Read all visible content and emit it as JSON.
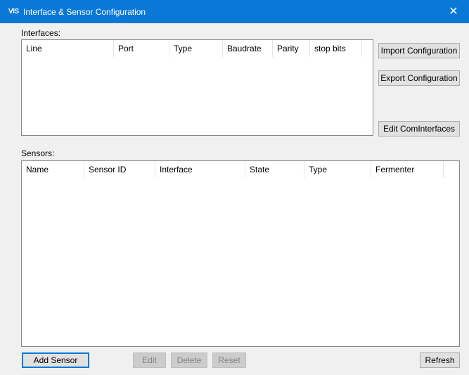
{
  "window": {
    "app_icon_text": "VIS",
    "title": "Interface & Sensor Configuration",
    "close_glyph": "✕",
    "accent_color": "#0a78d7"
  },
  "interfaces": {
    "label": "Interfaces:",
    "columns": [
      "Line",
      "Port",
      "Type",
      "Baudrate",
      "Parity",
      "stop bits"
    ],
    "rows": [],
    "buttons": {
      "import": "Import Configuration",
      "export": "Export Configuration",
      "edit_com": "Edit ComInterfaces"
    }
  },
  "sensors": {
    "label": "Sensors:",
    "columns": [
      "Name",
      "Sensor ID",
      "Interface",
      "State",
      "Type",
      "Fermenter"
    ],
    "rows": []
  },
  "footer": {
    "add_sensor": "Add Sensor",
    "edit": "Edit",
    "delete": "Delete",
    "reset": "Reset",
    "refresh": "Refresh"
  }
}
